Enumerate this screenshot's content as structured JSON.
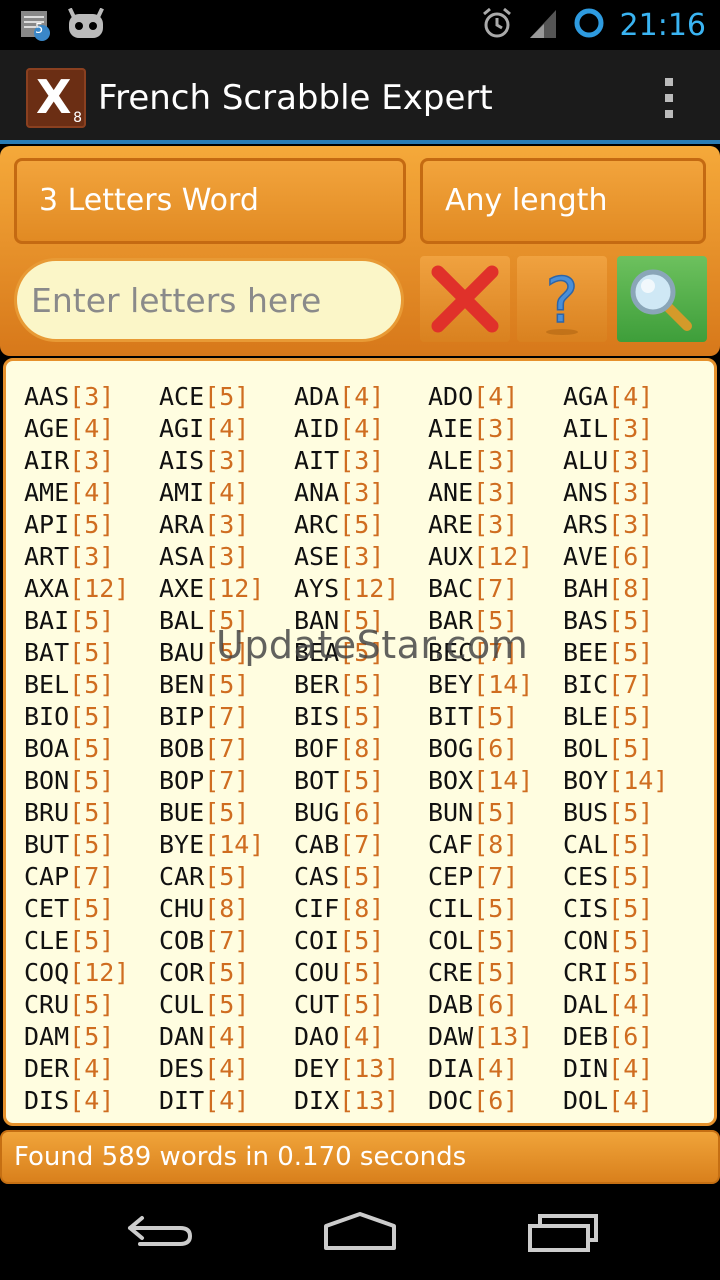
{
  "status_bar": {
    "time": "21:16",
    "notification_badge": "5",
    "icons": [
      "notes-icon",
      "cyanogen-icon",
      "alarm-icon",
      "signal-icon",
      "sync-ring-icon"
    ]
  },
  "action_bar": {
    "logo_letter": "X",
    "logo_sub": "8",
    "title": "French Scrabble Expert"
  },
  "controls": {
    "word_spinner": "3 Letters Word",
    "length_spinner": "Any length",
    "letters_placeholder": "Enter letters here"
  },
  "watermark": "UpdateStar.com",
  "results": [
    {
      "w": "AAS",
      "s": "[3]"
    },
    {
      "w": "ACE",
      "s": "[5]"
    },
    {
      "w": "ADA",
      "s": "[4]"
    },
    {
      "w": "ADO",
      "s": "[4]"
    },
    {
      "w": "AGA",
      "s": "[4]"
    },
    {
      "w": "AGE",
      "s": "[4]"
    },
    {
      "w": "AGI",
      "s": "[4]"
    },
    {
      "w": "AID",
      "s": "[4]"
    },
    {
      "w": "AIE",
      "s": "[3]"
    },
    {
      "w": "AIL",
      "s": "[3]"
    },
    {
      "w": "AIR",
      "s": "[3]"
    },
    {
      "w": "AIS",
      "s": "[3]"
    },
    {
      "w": "AIT",
      "s": "[3]"
    },
    {
      "w": "ALE",
      "s": "[3]"
    },
    {
      "w": "ALU",
      "s": "[3]"
    },
    {
      "w": "AME",
      "s": "[4]"
    },
    {
      "w": "AMI",
      "s": "[4]"
    },
    {
      "w": "ANA",
      "s": "[3]"
    },
    {
      "w": "ANE",
      "s": "[3]"
    },
    {
      "w": "ANS",
      "s": "[3]"
    },
    {
      "w": "API",
      "s": "[5]"
    },
    {
      "w": "ARA",
      "s": "[3]"
    },
    {
      "w": "ARC",
      "s": "[5]"
    },
    {
      "w": "ARE",
      "s": "[3]"
    },
    {
      "w": "ARS",
      "s": "[3]"
    },
    {
      "w": "ART",
      "s": "[3]"
    },
    {
      "w": "ASA",
      "s": "[3]"
    },
    {
      "w": "ASE",
      "s": "[3]"
    },
    {
      "w": "AUX",
      "s": "[12]"
    },
    {
      "w": "AVE",
      "s": "[6]"
    },
    {
      "w": "AXA",
      "s": "[12]"
    },
    {
      "w": "AXE",
      "s": "[12]"
    },
    {
      "w": "AYS",
      "s": "[12]"
    },
    {
      "w": "BAC",
      "s": "[7]"
    },
    {
      "w": "BAH",
      "s": "[8]"
    },
    {
      "w": "BAI",
      "s": "[5]"
    },
    {
      "w": "BAL",
      "s": "[5]"
    },
    {
      "w": "BAN",
      "s": "[5]"
    },
    {
      "w": "BAR",
      "s": "[5]"
    },
    {
      "w": "BAS",
      "s": "[5]"
    },
    {
      "w": "BAT",
      "s": "[5]"
    },
    {
      "w": "BAU",
      "s": "[5]"
    },
    {
      "w": "BEA",
      "s": "[5]"
    },
    {
      "w": "BEC",
      "s": "[7]"
    },
    {
      "w": "BEE",
      "s": "[5]"
    },
    {
      "w": "BEL",
      "s": "[5]"
    },
    {
      "w": "BEN",
      "s": "[5]"
    },
    {
      "w": "BER",
      "s": "[5]"
    },
    {
      "w": "BEY",
      "s": "[14]"
    },
    {
      "w": "BIC",
      "s": "[7]"
    },
    {
      "w": "BIO",
      "s": "[5]"
    },
    {
      "w": "BIP",
      "s": "[7]"
    },
    {
      "w": "BIS",
      "s": "[5]"
    },
    {
      "w": "BIT",
      "s": "[5]"
    },
    {
      "w": "BLE",
      "s": "[5]"
    },
    {
      "w": "BOA",
      "s": "[5]"
    },
    {
      "w": "BOB",
      "s": "[7]"
    },
    {
      "w": "BOF",
      "s": "[8]"
    },
    {
      "w": "BOG",
      "s": "[6]"
    },
    {
      "w": "BOL",
      "s": "[5]"
    },
    {
      "w": "BON",
      "s": "[5]"
    },
    {
      "w": "BOP",
      "s": "[7]"
    },
    {
      "w": "BOT",
      "s": "[5]"
    },
    {
      "w": "BOX",
      "s": "[14]"
    },
    {
      "w": "BOY",
      "s": "[14]"
    },
    {
      "w": "BRU",
      "s": "[5]"
    },
    {
      "w": "BUE",
      "s": "[5]"
    },
    {
      "w": "BUG",
      "s": "[6]"
    },
    {
      "w": "BUN",
      "s": "[5]"
    },
    {
      "w": "BUS",
      "s": "[5]"
    },
    {
      "w": "BUT",
      "s": "[5]"
    },
    {
      "w": "BYE",
      "s": "[14]"
    },
    {
      "w": "CAB",
      "s": "[7]"
    },
    {
      "w": "CAF",
      "s": "[8]"
    },
    {
      "w": "CAL",
      "s": "[5]"
    },
    {
      "w": "CAP",
      "s": "[7]"
    },
    {
      "w": "CAR",
      "s": "[5]"
    },
    {
      "w": "CAS",
      "s": "[5]"
    },
    {
      "w": "CEP",
      "s": "[7]"
    },
    {
      "w": "CES",
      "s": "[5]"
    },
    {
      "w": "CET",
      "s": "[5]"
    },
    {
      "w": "CHU",
      "s": "[8]"
    },
    {
      "w": "CIF",
      "s": "[8]"
    },
    {
      "w": "CIL",
      "s": "[5]"
    },
    {
      "w": "CIS",
      "s": "[5]"
    },
    {
      "w": "CLE",
      "s": "[5]"
    },
    {
      "w": "COB",
      "s": "[7]"
    },
    {
      "w": "COI",
      "s": "[5]"
    },
    {
      "w": "COL",
      "s": "[5]"
    },
    {
      "w": "CON",
      "s": "[5]"
    },
    {
      "w": "COQ",
      "s": "[12]"
    },
    {
      "w": "COR",
      "s": "[5]"
    },
    {
      "w": "COU",
      "s": "[5]"
    },
    {
      "w": "CRE",
      "s": "[5]"
    },
    {
      "w": "CRI",
      "s": "[5]"
    },
    {
      "w": "CRU",
      "s": "[5]"
    },
    {
      "w": "CUL",
      "s": "[5]"
    },
    {
      "w": "CUT",
      "s": "[5]"
    },
    {
      "w": "DAB",
      "s": "[6]"
    },
    {
      "w": "DAL",
      "s": "[4]"
    },
    {
      "w": "DAM",
      "s": "[5]"
    },
    {
      "w": "DAN",
      "s": "[4]"
    },
    {
      "w": "DAO",
      "s": "[4]"
    },
    {
      "w": "DAW",
      "s": "[13]"
    },
    {
      "w": "DEB",
      "s": "[6]"
    },
    {
      "w": "DER",
      "s": "[4]"
    },
    {
      "w": "DES",
      "s": "[4]"
    },
    {
      "w": "DEY",
      "s": "[13]"
    },
    {
      "w": "DIA",
      "s": "[4]"
    },
    {
      "w": "DIN",
      "s": "[4]"
    },
    {
      "w": "DIS",
      "s": "[4]"
    },
    {
      "w": "DIT",
      "s": "[4]"
    },
    {
      "w": "DIX",
      "s": "[13]"
    },
    {
      "w": "DOC",
      "s": "[6]"
    },
    {
      "w": "DOL",
      "s": "[4]"
    }
  ],
  "footer": {
    "status": "Found 589 words in 0.170 seconds"
  },
  "colors": {
    "accent_orange": "#e6912c",
    "score_color": "#cf6d20",
    "results_bg": "#fffde0",
    "time_blue": "#3ab4f2",
    "search_green": "#4fae45"
  }
}
